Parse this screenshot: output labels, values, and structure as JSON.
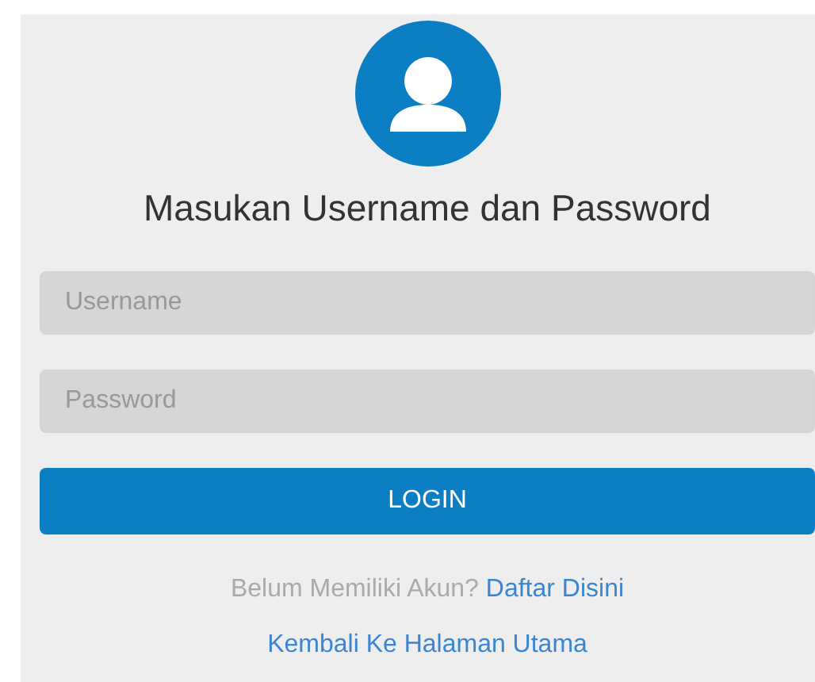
{
  "title": "Masukan Username dan Password",
  "fields": [
    {
      "placeholder": "Username"
    },
    {
      "placeholder": "Password"
    }
  ],
  "login_button": "LOGIN",
  "register_prompt": {
    "text": "Belum Memiliki Akun?",
    "link": "Daftar Disini"
  },
  "home_link": "Kembali Ke Halaman Utama"
}
